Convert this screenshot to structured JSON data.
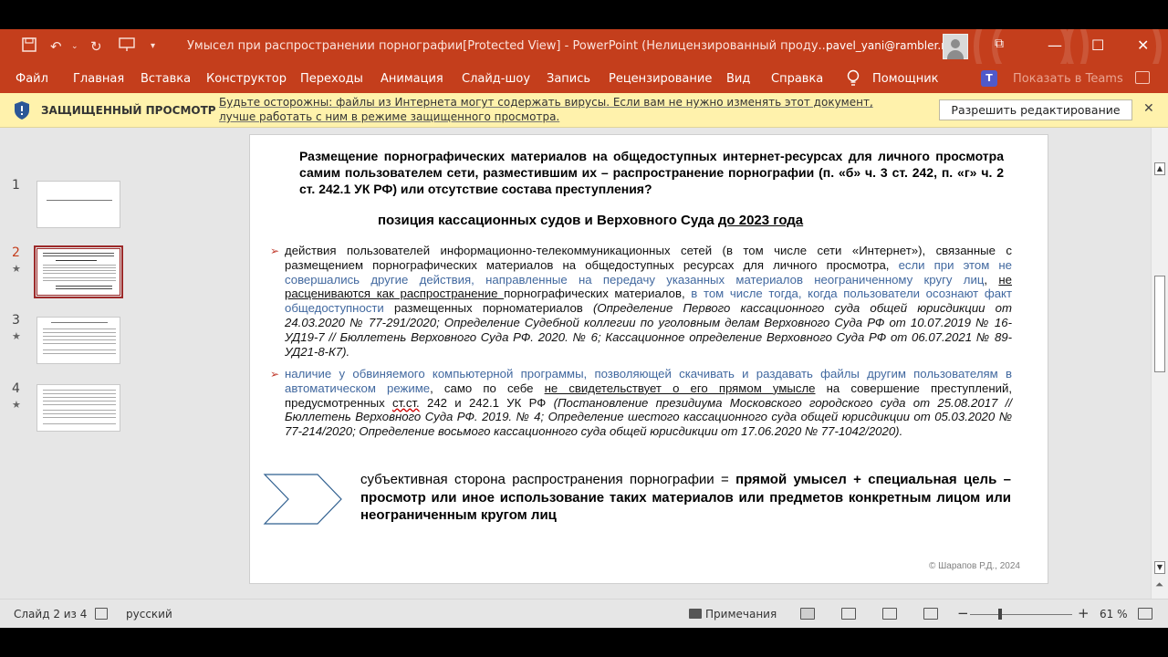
{
  "titlebar": {
    "doc_title": "Умысел при распространении порнографии[Protected View]  -  PowerPoint (Нелицензированный проду...",
    "user": "pavel_yani@rambler.ru"
  },
  "ribbon": {
    "tabs": [
      "Файл",
      "Главная",
      "Вставка",
      "Конструктор",
      "Переходы",
      "Анимация",
      "Слайд-шоу",
      "Запись",
      "Рецензирование",
      "Вид",
      "Справка",
      "Помощник"
    ],
    "teams": "Показать в Teams"
  },
  "protected": {
    "title": "ЗАЩИЩЕННЫЙ ПРОСМОТР",
    "message": "Будьте осторожны: файлы из Интернета могут содержать вирусы. Если вам не нужно изменять этот документ, лучше работать с ним в режиме защищенного просмотра.",
    "button": "Разрешить редактирование"
  },
  "thumbnails": {
    "numbers": [
      "1",
      "2",
      "3",
      "4"
    ],
    "star": "★"
  },
  "slide": {
    "title": "Размещение порнографических материалов на общедоступных интернет-ресурсах для личного просмотра самим пользователем сети, разместившим их – распространение порнографии (п. «б» ч. 3 ст. 242, п. «г» ч. 2 ст. 242.1 УК РФ) или отсутствие состава преступления?",
    "subtitle_a": "позиция кассационных судов и Верховного Суда ",
    "subtitle_b": "до 2023 года",
    "bullet1": {
      "p1": "действия пользователей информационно-телекоммуникационных сетей (в том числе сети «Интернет»), связанные с размещением порнографических материалов на общедоступных ресурсах для личного просмотра, ",
      "p2": "если при этом не совершались другие действия, направленные на передачу указанных материалов неограниченному кругу лиц",
      "p3": ", ",
      "p4": "не расцениваются как распространение ",
      "p5": "порнографических материалов, ",
      "p6": "в том числе тогда, когда пользователи осознают факт общедоступности",
      "p7": " размещенных порноматериалов ",
      "p8": "(Определение Первого кассационного суда общей юрисдикции от 24.03.2020 № 77-291/2020; Определение Судебной коллегии по уголовным делам Верховного Суда РФ от 10.07.2019 № 16-УД19-7 // Бюллетень Верховного Суда РФ. 2020. № 6; Кассационное определение Верховного Суда РФ от 06.07.2021 № 89-УД21-8-К7)."
    },
    "bullet2": {
      "p1": "наличие у обвиняемого компьютерной программы, позволяющей скачивать и раздавать файлы другим пользователям в автоматическом режиме",
      "p2": ", само по себе ",
      "p3": "не свидетельствует о его прямом умысле",
      "p4": " на совершение преступлений, предусмотренных ",
      "p5": "ст.ст.",
      "p6": " 242 и 242.1 УК РФ ",
      "p7": "(Постановление президиума Московского городского суда от 25.08.2017 // Бюллетень Верховного Суда РФ. 2019. № 4; Определение шестого кассационного суда общей юрисдикции от 05.03.2020 № 77-214/2020; Определение восьмого кассационного суда общей юрисдикции от 17.06.2020 № 77-1042/2020)."
    },
    "conclusion_a": "субъективная сторона распространения порнографии = ",
    "conclusion_b": "прямой умысел + специальная цель – просмотр или иное использование таких материалов или предметов конкретным лицом или неограниченным кругом лиц",
    "copyright": "© Шарапов Р.Д., 2024"
  },
  "status": {
    "slide_counter": "Слайд 2 из 4",
    "language": "русский",
    "notes": "Примечания",
    "minus": "−",
    "plus": "+",
    "zoom": "61 %"
  },
  "colors": {
    "accent": "#c43e1c",
    "protected_bar": "#fff2ac",
    "link_blue": "#41689f",
    "selected_thumb": "#9d2a2a"
  }
}
